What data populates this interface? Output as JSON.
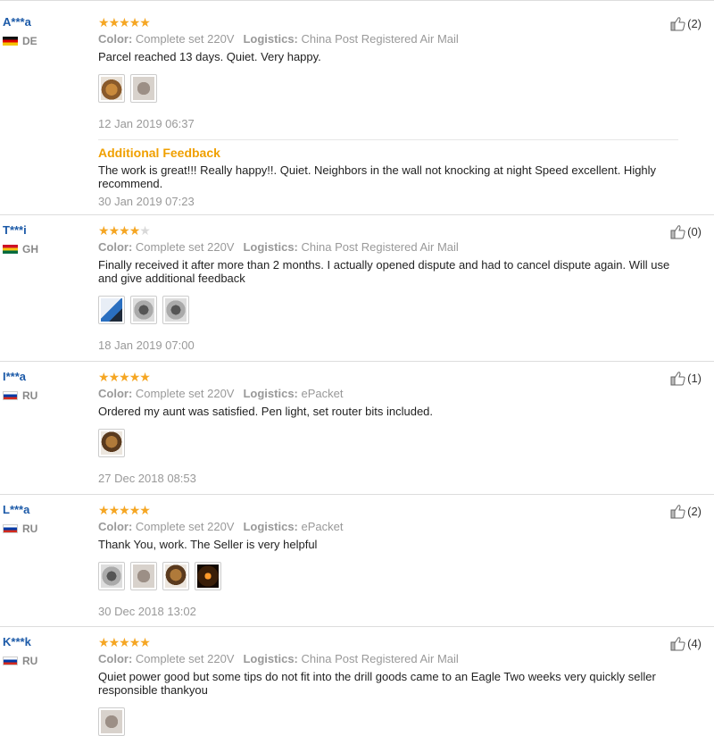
{
  "labels": {
    "color": "Color:",
    "logistics": "Logistics:",
    "additional_feedback": "Additional Feedback"
  },
  "colors": {
    "star": "#f5a623",
    "buyer_name": "#1c5aa8",
    "followup": "#f0a000"
  },
  "reviews": [
    {
      "buyer": "A***a",
      "country": "DE",
      "stars": 5,
      "color": "Complete set 220V",
      "logistics": "China Post Registered Air Mail",
      "text": "Parcel reached 13 days. Quiet. Very happy.",
      "photos": 2,
      "date": "12 Jan 2019 06:37",
      "helpful": "(2)",
      "followup": {
        "text": "The work is great!!! Really happy!!. Quiet. Neighbors in the wall not knocking at night Speed excellent. Highly recommend.",
        "date": "30 Jan 2019 07:23"
      }
    },
    {
      "buyer": "T***i",
      "country": "GH",
      "stars": 4,
      "color": "Complete set 220V",
      "logistics": "China Post Registered Air Mail",
      "text": "Finally received it after more than 2 months. I actually opened dispute and had to cancel dispute again. Will use and give additional feedback",
      "photos": 3,
      "date": "18 Jan 2019 07:00",
      "helpful": "(0)"
    },
    {
      "buyer": "I***a",
      "country": "RU",
      "stars": 5,
      "color": "Complete set 220V",
      "logistics": "ePacket",
      "text": "Ordered my aunt was satisfied. Pen light, set router bits included.",
      "photos": 1,
      "date": "27 Dec 2018 08:53",
      "helpful": "(1)"
    },
    {
      "buyer": "L***a",
      "country": "RU",
      "stars": 5,
      "color": "Complete set 220V",
      "logistics": "ePacket",
      "text": "Thank You, work. The Seller is very helpful",
      "photos": 4,
      "date": "30 Dec 2018 13:02",
      "helpful": "(2)"
    },
    {
      "buyer": "K***k",
      "country": "RU",
      "stars": 5,
      "color": "Complete set 220V",
      "logistics": "China Post Registered Air Mail",
      "text": "Quiet power good but some tips do not fit into the drill goods came to an Eagle Two weeks very quickly seller responsible thankyou",
      "photos": 1,
      "date": "",
      "helpful": "(4)"
    }
  ]
}
